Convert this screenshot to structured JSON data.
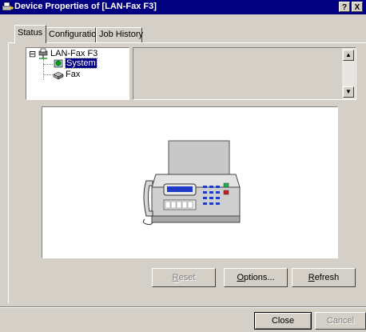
{
  "window": {
    "title": "Device Properties of [LAN-Fax F3]",
    "help_label": "?",
    "close_label": "X"
  },
  "tabs": [
    {
      "label": "Status",
      "active": true
    },
    {
      "label": "Configuration",
      "active": false
    },
    {
      "label": "Job History",
      "active": false
    }
  ],
  "tree": {
    "root": {
      "label": "LAN-Fax F3",
      "expander": "⊟",
      "icon": "network-printer-icon"
    },
    "children": [
      {
        "label": "System",
        "selected": true,
        "icon": "system-icon"
      },
      {
        "label": "Fax",
        "selected": false,
        "icon": "fax-device-icon"
      }
    ]
  },
  "device_image": {
    "icon": "fax-machine-illustration"
  },
  "buttons": {
    "reset": {
      "label": "Reset",
      "mnemonic": "R",
      "rest": "eset",
      "enabled": false
    },
    "options": {
      "label": "Options...",
      "mnemonic": "O",
      "rest": "ptions...",
      "enabled": true
    },
    "refresh": {
      "label": "Refresh",
      "mnemonic": "R",
      "rest": "efresh",
      "enabled": true
    },
    "close": {
      "label": "Close",
      "enabled": true
    },
    "cancel": {
      "label": "Cancel",
      "enabled": false
    }
  },
  "colors": {
    "titlebar": "#000080",
    "face": "#d4d0c8",
    "selection": "#000080",
    "led_green": "#22b14c",
    "led_red": "#d11a1a",
    "keypad": "#1e3cc8"
  }
}
